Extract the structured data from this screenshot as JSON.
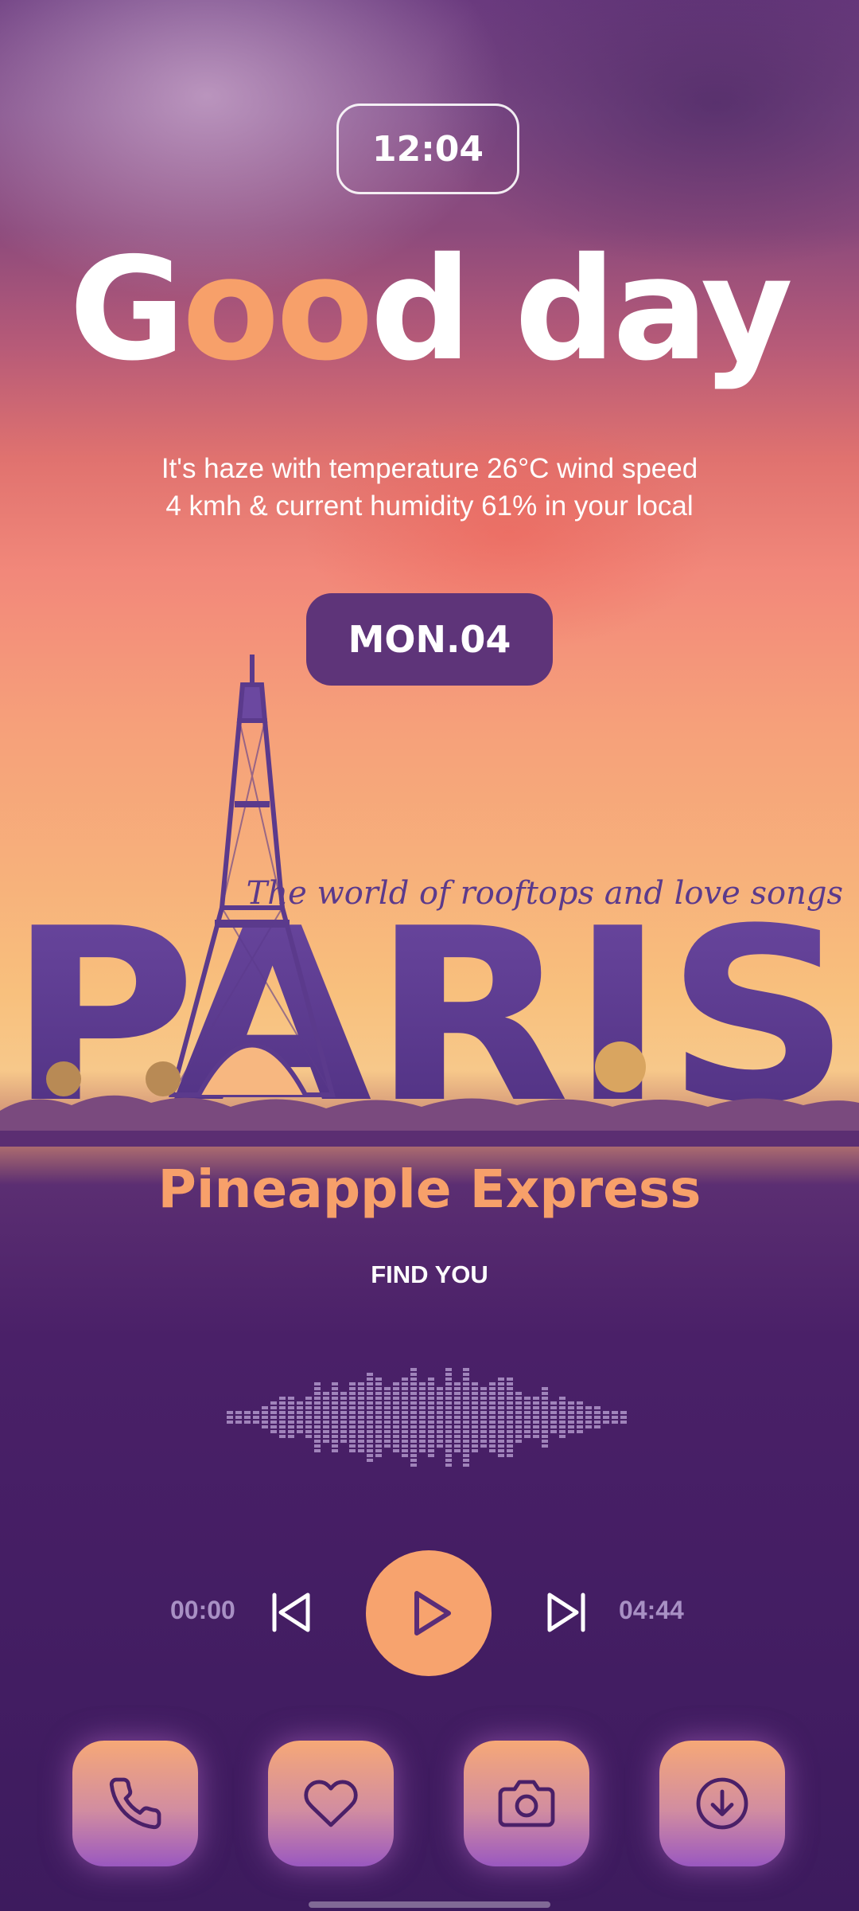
{
  "status": {
    "time": "12:04"
  },
  "greeting": {
    "prefix": "G",
    "highlight": "oo",
    "suffix": "d day"
  },
  "weather": {
    "text": "It's haze with temperature 26°C wind speed 4 kmh & current humidity 61% in your local"
  },
  "date": {
    "label": "MON.04"
  },
  "artwork": {
    "tagline": "The world of rooftops and love songs",
    "word": "PARIS"
  },
  "player": {
    "title": "Pineapple Express",
    "artist": "FIND YOU",
    "current_time": "00:00",
    "total_time": "04:44",
    "progress": 0,
    "controls": {
      "prev_icon": "skip-previous-icon",
      "play_icon": "play-icon",
      "next_icon": "skip-next-icon"
    }
  },
  "dock": [
    {
      "icon": "phone-icon"
    },
    {
      "icon": "heart-icon"
    },
    {
      "icon": "camera-icon"
    },
    {
      "icon": "download-icon"
    }
  ],
  "colors": {
    "accent": "#f7a36e",
    "purple_dark": "#3d1b5e",
    "purple_pill": "#5e3479",
    "paris_letters": "#5b3a8c",
    "white": "#ffffff"
  }
}
